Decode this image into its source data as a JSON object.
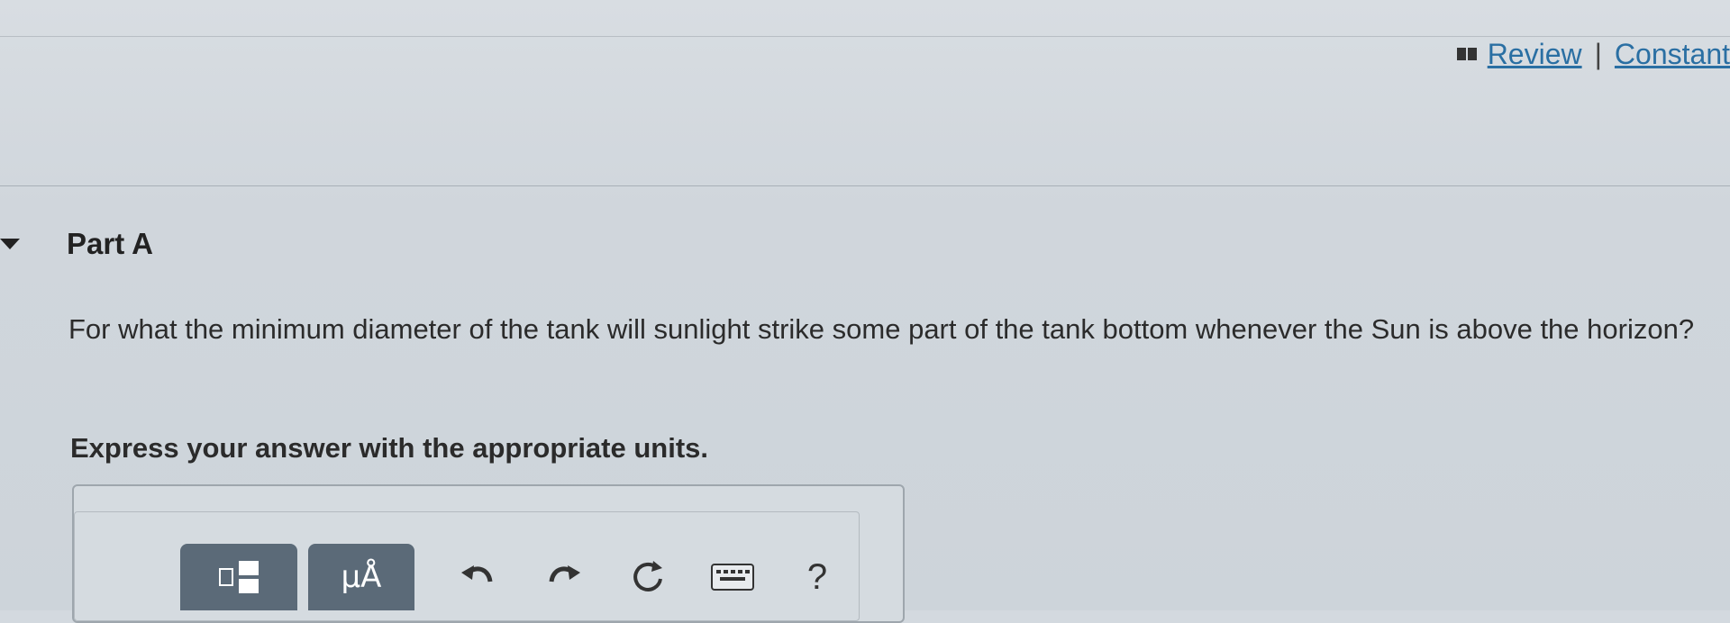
{
  "header": {
    "review_label": "Review",
    "separator": "|",
    "constants_label": "Constant"
  },
  "part": {
    "title": "Part A"
  },
  "question": {
    "text": "For what the minimum diameter of the tank will sunlight strike some part of the tank bottom whenever the Sun is above the horizon?",
    "instruction": "Express your answer with the appropriate units."
  },
  "toolbar": {
    "units_symbol": "μÅ",
    "help_symbol": "?"
  },
  "icons": {
    "book": "book-icon",
    "caret": "caret-down-icon",
    "templates": "templates-icon",
    "units": "units-icon",
    "undo": "undo-icon",
    "redo": "redo-icon",
    "reset": "reset-icon",
    "keyboard": "keyboard-icon",
    "help": "help-icon"
  },
  "colors": {
    "link": "#2a6fa3",
    "toolbar_button": "#5b6a78",
    "background": "#d3d9df"
  }
}
